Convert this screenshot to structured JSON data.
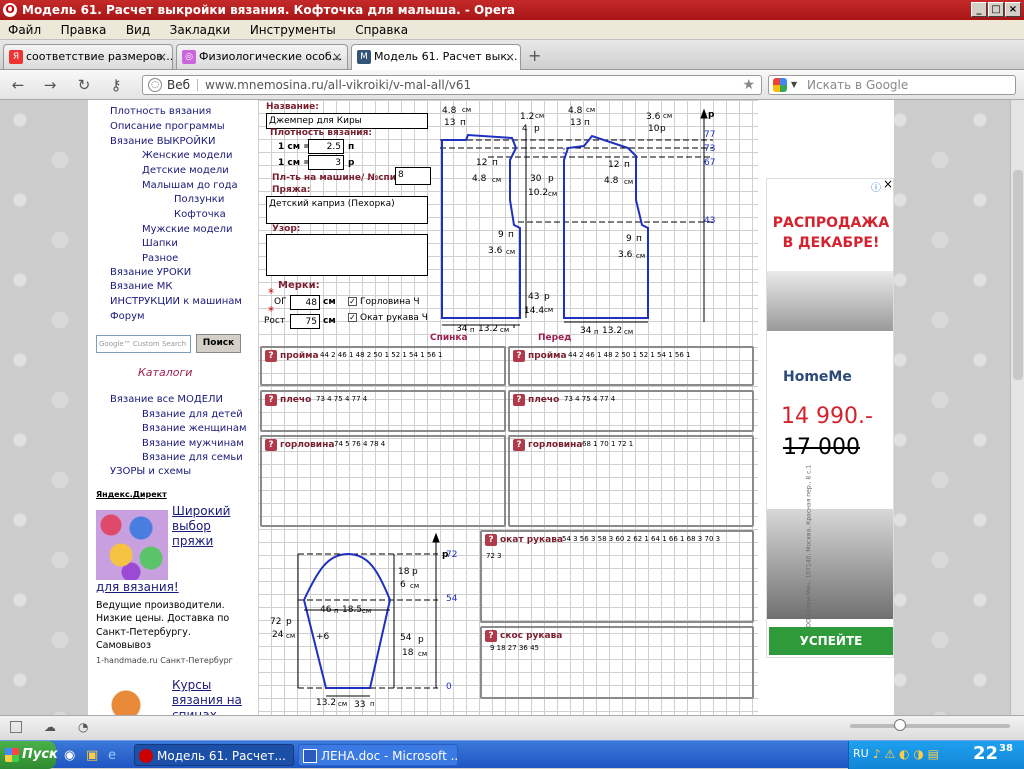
{
  "window": {
    "title": "Модель 61. Расчет выкройки вязания. Кофточка для малыша. - Opera",
    "controls": [
      "_",
      "□",
      "×"
    ]
  },
  "menu": [
    "Файл",
    "Правка",
    "Вид",
    "Закладки",
    "Инструменты",
    "Справка"
  ],
  "tabs": [
    {
      "label": "соответствие размеров...",
      "icon": "Я"
    },
    {
      "label": "Физиологические особ...",
      "icon": "◎"
    },
    {
      "label": "Модель 61. Расчет вык...",
      "icon": "M",
      "active": true
    }
  ],
  "address": {
    "prefix": "Веб",
    "url": "www.mnemosina.ru/all-vikroiki/v-mal-all/v61",
    "search_placeholder": "Искать в Google"
  },
  "leftnav": {
    "items": [
      {
        "label": "Плотность вязания",
        "indent": 0
      },
      {
        "label": "Описание программы",
        "indent": 0
      },
      {
        "label": "Вязание ВЫКРОЙКИ",
        "indent": 0
      },
      {
        "label": "Женские модели",
        "indent": 1
      },
      {
        "label": "Детские модели",
        "indent": 1
      },
      {
        "label": "Малышам до года",
        "indent": 1
      },
      {
        "label": "Ползунки",
        "indent": 2
      },
      {
        "label": "Кофточка",
        "indent": 2
      },
      {
        "label": "Мужские модели",
        "indent": 1
      },
      {
        "label": "Шапки",
        "indent": 1
      },
      {
        "label": "Разное",
        "indent": 1
      },
      {
        "label": "Вязание УРОКИ",
        "indent": 0
      },
      {
        "label": "Вязание МК",
        "indent": 0
      },
      {
        "label": "ИНСТРУКЦИИ к машинам",
        "indent": 0
      },
      {
        "label": "Форум",
        "indent": 0
      }
    ],
    "search_placeholder": "Google™ Custom Search",
    "search_button": "Поиск",
    "catalog_title": "Каталоги",
    "catalog_items": [
      {
        "label": "Вязание все МОДЕЛИ",
        "indent": 0
      },
      {
        "label": "Вязание для детей",
        "indent": 1
      },
      {
        "label": "Вязание женщинам",
        "indent": 1
      },
      {
        "label": "Вязание мужчинам",
        "indent": 1
      },
      {
        "label": "Вязание для семьи",
        "indent": 1
      },
      {
        "label": "УЗОРЫ и схемы",
        "indent": 0
      }
    ],
    "yandex_label": "Яндекс.Директ",
    "ad1_title": "Широкий выбор пряжи",
    "ad1_title2": "для вязания!",
    "ad1_lines": [
      "Ведущие производители.",
      "Низкие цены. Доставка по",
      "Санкт-Петербургу.",
      "Самовывоз"
    ],
    "ad1_source": "1-handmade.ru Санкт-Петербург",
    "ad2_title": "Курсы вязания на спицах"
  },
  "form": {
    "name_label": "Название:",
    "name_value": "Джемпер для Киры",
    "density_label": "Плотность вязания:",
    "cm1": "1 см =",
    "cm1_value": "2.5",
    "cm1_unit": "п",
    "cm2": "1 см =",
    "cm2_value": "3",
    "cm2_unit": "р",
    "machine_label": "Пл-ть на машине/ №спиц",
    "machine_value": "8",
    "yarn_label": "Пряжа:",
    "yarn_value": "Детский каприз (Пехорка)",
    "pattern_label": "Узор:",
    "marks_label": "Мерки:",
    "og_label": "ОГ",
    "og_value": "48",
    "og_unit": "см",
    "rost_label": "Рост",
    "rost_value": "75",
    "rost_unit": "см",
    "neck_label": "Горловина Ч",
    "sleeve_label": "Окат рукава Ч"
  },
  "pattern": {
    "back_label": "Спинка",
    "front_label": "Перед",
    "p_axis": "р",
    "rows_right": [
      "77",
      "73",
      "67",
      "43"
    ],
    "back": {
      "top_w": "4.8",
      "top_w_unit": "см",
      "top_p": "13",
      "top_p_unit": "п",
      "neck_h": "1.2",
      "neck_h_unit": "см",
      "neck_r": "4",
      "neck_r_unit": "р",
      "shoulder_p": "12",
      "shoulder_p_unit": "п",
      "shoulder_cm": "4.8",
      "shoulder_cm_unit": "см",
      "arm_r": "30",
      "arm_r_unit": "р",
      "arm_cm": "10.2",
      "arm_cm_unit": "см",
      "under_p": "9",
      "under_p_unit": "п",
      "under_cm": "3.6",
      "under_cm_unit": "см",
      "body_r": "43",
      "body_r_unit": "р",
      "body_cm": "14.4",
      "body_cm_unit": "см",
      "bottom_p": "34",
      "bottom_p_unit": "п",
      "bottom_cm": "13.2",
      "bottom_cm_unit": "см"
    },
    "front": {
      "top_w": "4.8",
      "top_w_unit": "см",
      "top_p": "13",
      "top_p_unit": "п",
      "neck_h": "3.6",
      "neck_h_unit": "см",
      "neck_p": "10",
      "neck_p_unit": "р",
      "shoulder_p": "12",
      "shoulder_p_unit": "п",
      "shoulder_cm": "4.8",
      "shoulder_cm_unit": "см",
      "under_p": "9",
      "under_p_unit": "п",
      "under_cm": "3.6",
      "under_cm_unit": "см",
      "bottom_p": "34",
      "bottom_p_unit": "п",
      "bottom_cm": "13.2",
      "bottom_cm_unit": "см"
    },
    "sleeve": {
      "top_r": "72",
      "cap_r": "18",
      "cap_r_unit": "р",
      "cap_cm": "6",
      "cap_cm_unit": "см",
      "mid_r": "54",
      "width_p": "46",
      "width_p_unit": "п",
      "width_cm": "18.5",
      "width_cm_unit": "см",
      "total_r": "72",
      "total_r_unit": "р",
      "total_cm": "24",
      "total_cm_unit": "см",
      "inc": "+6",
      "body_r": "54",
      "body_r_unit": "р",
      "body_cm": "18",
      "body_cm_unit": "см",
      "zero": "0",
      "bottom_cm": "13.2",
      "bottom_cm_unit": "см",
      "bottom_p": "33",
      "bottom_p_unit": "п"
    }
  },
  "sections": {
    "back_armhole": {
      "title": "пройма",
      "nums": "44  2  46  1  48  2  50  1  52  1  54  1  56  1"
    },
    "front_armhole": {
      "title": "пройма",
      "nums": "44  2  46  1  48  2  50  1  52  1  54  1  56  1"
    },
    "back_shoulder": {
      "title": "плечо",
      "nums": "73  4  75  4  77  4"
    },
    "front_shoulder": {
      "title": "плечо",
      "nums": "73  4  75  4  77  4"
    },
    "back_neck": {
      "title": "горловина",
      "nums": "74  5  76  4  78  4"
    },
    "front_neck": {
      "title": "горловина",
      "nums": "68  1  70  1  72  1"
    },
    "sleeve_cap": {
      "title": "окат рукава",
      "nums": "54  3  56  3  58  3  60  2  62  1  64  1  66  1  68  3  70  3",
      "nums2": "72  3"
    },
    "sleeve_bevel": {
      "title": "скос рукава",
      "nums": "9    18    27    36    45"
    }
  },
  "right_ad": {
    "headline1": "РАСПРОДАЖА",
    "headline2": "В ДЕКАБРЕ!",
    "brand": "HomeMe",
    "price_new": "14 990.-",
    "price_old": "17 000",
    "side_text": "ООО «Хоум Ми», 107140, Москва, Красная пер., 8 с.1",
    "cta": "УСПЕЙТЕ ЗАКАЗАТЬ"
  },
  "taskbar": {
    "start": "Пуск",
    "items": [
      "Модель 61. Расчет...",
      "ЛЕНА.doc - Microsoft ..."
    ],
    "lang": "RU",
    "time": "22",
    "time_min": "38"
  },
  "colors": {
    "accent_red": "#b03a4a",
    "line_blue": "#1f2fbf",
    "ad_red": "#d3232f",
    "ad_green": "#2f9a3a"
  }
}
